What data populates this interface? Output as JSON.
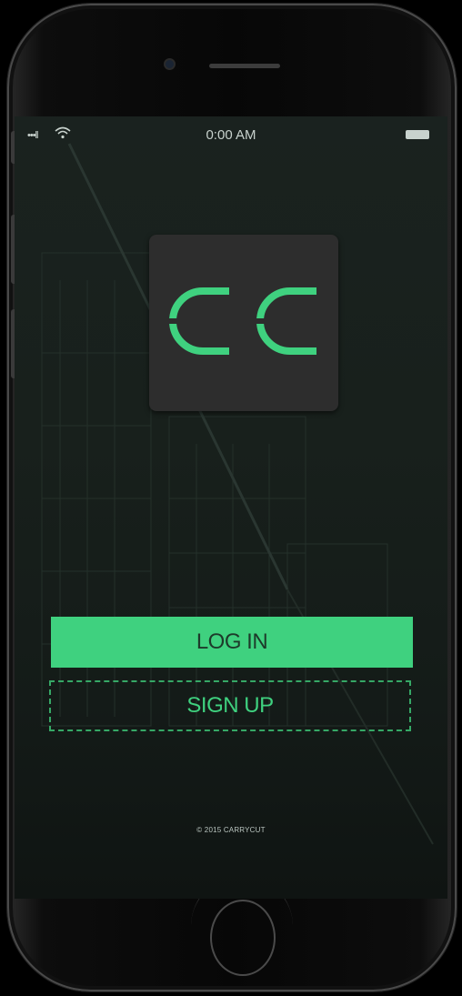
{
  "status_bar": {
    "signal": "•••ll",
    "time": "0:00 AM"
  },
  "logo": {
    "text": "CC",
    "accent_color": "#3fd17f",
    "tile_color": "#2d2d2d"
  },
  "actions": {
    "login_label": "LOG IN",
    "signup_label": "SIGN UP"
  },
  "footer": {
    "copyright": "© 2015 CARRYCUT"
  },
  "icons": {
    "wifi": "wifi-icon",
    "battery": "battery-icon",
    "signal": "signal-icon"
  },
  "colors": {
    "accent": "#3fd17f",
    "background": "#18201c"
  }
}
